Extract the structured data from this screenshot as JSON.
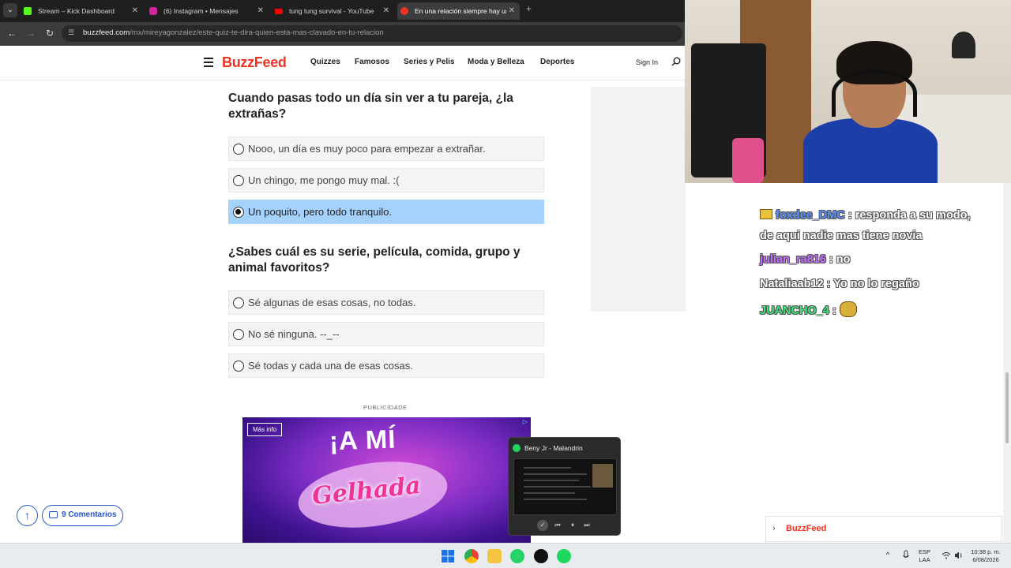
{
  "browser": {
    "tabs": [
      {
        "title": "Stream – Kick Dashboard",
        "favicon_color": "#53fc18"
      },
      {
        "title": "(6) Instagram • Mensajes",
        "favicon_color": "#d6249f"
      },
      {
        "title": "tung tung survival - YouTube",
        "favicon_color": "#ff0000"
      },
      {
        "title": "En una relación siempre hay un",
        "favicon_color": "#ee3322"
      }
    ],
    "close_glyph": "✕",
    "newtab_glyph": "+",
    "url_host": "buzzfeed.com",
    "url_path": "/mx/mireyagonzalez/este-quiz-te-dira-quien-esta-mas-clavado-en-tu-relacion"
  },
  "buzzfeed": {
    "logo": "BuzzFeed",
    "nav": [
      "Quizzes",
      "Famosos",
      "Series y Pelis",
      "Moda y Belleza",
      "Deportes"
    ],
    "sign_in": "Sign In"
  },
  "quiz": {
    "q1": {
      "title": "Cuando pasas todo un día sin ver a tu pareja, ¿la extrañas?",
      "options": [
        "Nooo, un día es muy poco para empezar a extrañar.",
        "Un chingo, me pongo muy mal. :(",
        "Un poquito, pero todo tranquilo."
      ],
      "selected_index": 2
    },
    "q2": {
      "title": "¿Sabes cuál es su serie, película, comida, grupo y animal favoritos?",
      "options": [
        "Sé algunas de esas cosas, no todas.",
        "No sé ninguna. --_--",
        "Sé todas y cada una de esas cosas."
      ]
    }
  },
  "ad": {
    "label": "PUBLICIDADE",
    "more_info": "Más info",
    "adchoices_glyph": "▷",
    "headline": "¡A MÍ",
    "brand": "Gelhada"
  },
  "footer_buttons": {
    "up_glyph": "↑",
    "comments": "9 Comentarios"
  },
  "media_player": {
    "track": "Beny Jr - Malandrin",
    "controls": [
      "✓",
      "⏮",
      "⏸",
      "⏭"
    ]
  },
  "chat": [
    {
      "user": "foxdee_DMC",
      "user_color": "#5b8ff9",
      "text": " : responda a su modo,",
      "badge": "crown-icon"
    },
    {
      "user": "",
      "user_color": "#ffffff",
      "text": "de aqui nadie mas tiene novia"
    },
    {
      "user": "julian_ra816",
      "user_color": "#c46cff",
      "text": " : no"
    },
    {
      "user": "Nataliaab12",
      "user_color": "#ffffff",
      "text": " : Yo no lo regaño"
    },
    {
      "user": "JUANCHO_4",
      "user_color": "#3fe07a",
      "text": " : ",
      "emote": "emote-icon"
    }
  ],
  "notification": {
    "chevron": "›",
    "brand": "BuzzFeed"
  },
  "taskbar": {
    "lang": "ESP",
    "region": "LAA",
    "time": "10:38 p. m.",
    "date": "6/08/2026",
    "chevron": "^"
  }
}
